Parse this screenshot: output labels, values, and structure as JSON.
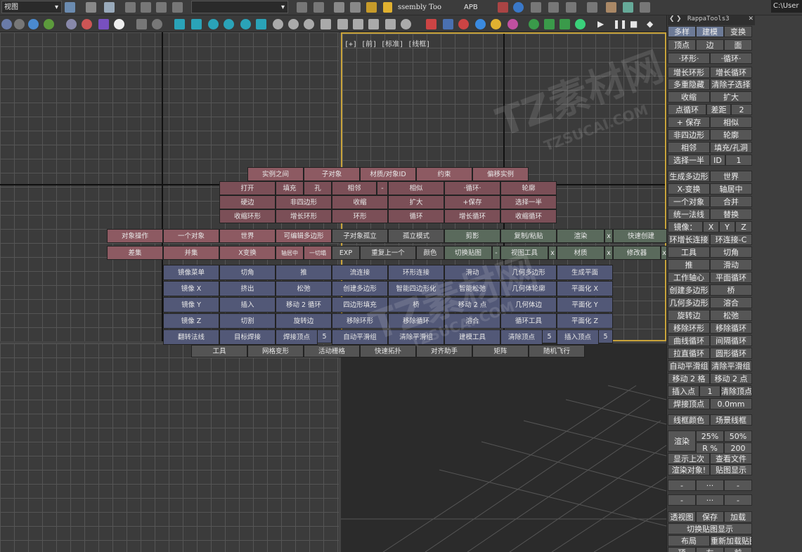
{
  "toolbar": {
    "view_dropdown": "视图",
    "layer_dropdown": "",
    "assembly_label": "ssembly Too",
    "apb_label": "APB",
    "path_label": "C:\\User"
  },
  "viewport": {
    "label": "[+] [前] [标准] [线框]"
  },
  "quad_menu": {
    "red_top": [
      "实例之间",
      "子对象",
      "材质/对象ID",
      "约束",
      "偏移实例"
    ],
    "red_rows": [
      [
        "打开",
        "填充",
        "孔",
        "相邻",
        "-",
        "相似",
        "·循环·",
        "轮廓"
      ],
      [
        "硬边",
        "非四边形",
        "收缩",
        "扩大",
        "+保存",
        "选择一半"
      ],
      [
        "收缩环形",
        "增长环形",
        "环形",
        "循环",
        "增长循环",
        "收缩循环"
      ]
    ],
    "red_left": [
      "对象操作",
      "一个对象",
      "世界",
      "可编辑多边形"
    ],
    "red_left2": [
      "差集",
      "并集",
      "X变换",
      "轴居中",
      "一切塌"
    ],
    "green_top": [
      "子对象孤立",
      "孤立模式",
      "剪影",
      "复制/粘贴",
      "渲染",
      "x",
      "快速创建"
    ],
    "green_bottom": [
      "EXP",
      "重复上一个",
      "颜色",
      "切换贴图",
      "-",
      "视图工具",
      "x",
      "材质",
      "x",
      "修改器",
      "x"
    ],
    "blue_rows": [
      [
        "镜像菜单",
        "切角",
        "推",
        "流连接",
        "环形连接",
        "滑动",
        "几何多边形",
        "生成平面"
      ],
      [
        "镜像 X",
        "挤出",
        "松弛",
        "创建多边形",
        "智能四边形化",
        "智能松弛",
        "几何体轮廓",
        "平面化 X"
      ],
      [
        "镜像 Y",
        "插入",
        "移动 2 循环",
        "四边形填充",
        "桥",
        "移动 2 点",
        "几何体边",
        "平面化 Y"
      ],
      [
        "镜像 Z",
        "切割",
        "旋转边",
        "移除环形",
        "移除循环",
        "溶合",
        "循环工具",
        "平面化 Z"
      ],
      [
        "翻转法线",
        "目标焊接",
        "焊接顶点",
        "自动平滑组",
        "清除平滑组",
        "建模工具",
        "清除顶点",
        "插入顶点"
      ]
    ],
    "blue_nums": [
      "5",
      "5",
      "5"
    ],
    "gray_bottom": [
      "工具",
      "网格变形",
      "活动栅格",
      "快速拓扑",
      "对齐助手",
      "矩阵",
      "随机飞行"
    ]
  },
  "rappa": {
    "title": "RappaTools3",
    "rows": [
      [
        "多样",
        "建模",
        "变换"
      ],
      [
        "顶点",
        "边",
        "面"
      ],
      [
        "·环形·",
        "·循环·"
      ],
      [
        "增长环形",
        "增长循环"
      ],
      [
        "多重隐藏",
        "清除子选择"
      ],
      [
        "收缩",
        "扩大"
      ],
      [
        "点循环",
        "差距",
        "2"
      ],
      [
        "+ 保存",
        "相似"
      ],
      [
        "非四边形",
        "轮廓"
      ],
      [
        "相邻",
        "填充/孔洞"
      ],
      [
        "选择一半",
        "ID",
        "1"
      ],
      [
        "生成多边形",
        "世界"
      ],
      [
        "X-变换",
        "轴居中"
      ],
      [
        "一个对象",
        "合并"
      ],
      [
        "统一法线",
        "替换"
      ],
      [
        "镜像：",
        "X",
        "Y",
        "Z"
      ],
      [
        "环增长连接",
        "环连接-C"
      ],
      [
        "工具",
        "切角"
      ],
      [
        "推",
        "滑动"
      ],
      [
        "工作轴心",
        "平面循环"
      ],
      [
        "创建多边形",
        "桥"
      ],
      [
        "几何多边形",
        "溶合"
      ],
      [
        "旋转边",
        "松弛"
      ],
      [
        "移除环形",
        "移除循环"
      ],
      [
        "曲线循环",
        "间隔循环"
      ],
      [
        "拉直循环",
        "圆形循环"
      ],
      [
        "自动平滑组",
        "清除平滑组"
      ],
      [
        "移动 2 格",
        "移动 2 点"
      ],
      [
        "插入点",
        "1",
        "清除顶点"
      ],
      [
        "焊接顶点",
        "0.0mm"
      ],
      [
        "线框颜色",
        "场景线框"
      ],
      [
        "渲染",
        "25%",
        "50%"
      ],
      [
        "R %",
        "200"
      ],
      [
        "显示上次",
        "查看文件"
      ],
      [
        "渲染对象!",
        "贴图显示"
      ],
      [
        "-",
        "···",
        "-"
      ],
      [
        "-",
        "···",
        "-"
      ],
      [
        "透视图",
        "保存",
        "加载"
      ],
      [
        "切换贴图显示"
      ],
      [
        "布局",
        "重新加载贴图"
      ],
      [
        "顶",
        "左",
        "前"
      ]
    ]
  },
  "watermark": {
    "text1": "TZ素材网",
    "text2": "TZSUCAI.COM"
  }
}
